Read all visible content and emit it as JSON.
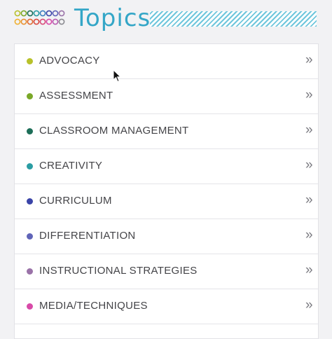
{
  "header": {
    "title": "Topics",
    "logo_icon": "circles-grid-icon"
  },
  "topics": [
    {
      "label": "ADVOCACY",
      "color": "#b8c12a"
    },
    {
      "label": "ASSESSMENT",
      "color": "#7aa828"
    },
    {
      "label": "CLASSROOM MANAGEMENT",
      "color": "#1d6e58"
    },
    {
      "label": "CREATIVITY",
      "color": "#2a9da3"
    },
    {
      "label": "CURRICULUM",
      "color": "#3a44a8"
    },
    {
      "label": "DIFFERENTIATION",
      "color": "#6064b8"
    },
    {
      "label": "INSTRUCTIONAL STRATEGIES",
      "color": "#9a72a8"
    },
    {
      "label": "MEDIA/TECHNIQUES",
      "color": "#d84aa8"
    }
  ],
  "chevron_glyph": "»"
}
